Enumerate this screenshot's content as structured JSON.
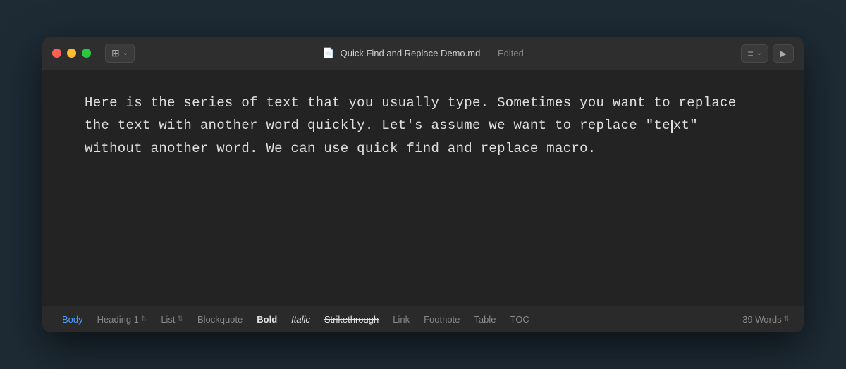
{
  "window": {
    "title": "Quick Find and Replace Demo.md",
    "edited_label": "— Edited"
  },
  "titlebar": {
    "traffic_lights": {
      "close": "close",
      "minimize": "minimize",
      "maximize": "maximize"
    },
    "sidebar_toggle_label": "⊞",
    "doc_icon": "📄",
    "list_view_icon": "≡",
    "play_icon": "▶"
  },
  "editor": {
    "content": "Here is the series of text that you usually type. Sometimes you want to replace the text with another word quickly. Let's assume we want to replace \"text\" without another word. We can use quick find and replace macro."
  },
  "statusbar": {
    "items": [
      {
        "id": "body",
        "label": "Body",
        "active": true
      },
      {
        "id": "heading1",
        "label": "Heading 1",
        "has_arrow": true
      },
      {
        "id": "list",
        "label": "List",
        "has_arrow": true
      },
      {
        "id": "blockquote",
        "label": "Blockquote",
        "has_arrow": false
      },
      {
        "id": "bold",
        "label": "Bold",
        "style": "bold"
      },
      {
        "id": "italic",
        "label": "Italic",
        "style": "italic"
      },
      {
        "id": "strikethrough",
        "label": "Strikethrough",
        "style": "strike"
      },
      {
        "id": "link",
        "label": "Link",
        "has_arrow": false
      },
      {
        "id": "footnote",
        "label": "Footnote",
        "has_arrow": false
      },
      {
        "id": "table",
        "label": "Table",
        "has_arrow": false
      },
      {
        "id": "toc",
        "label": "TOC",
        "has_arrow": false
      }
    ],
    "word_count": "39 Words"
  }
}
